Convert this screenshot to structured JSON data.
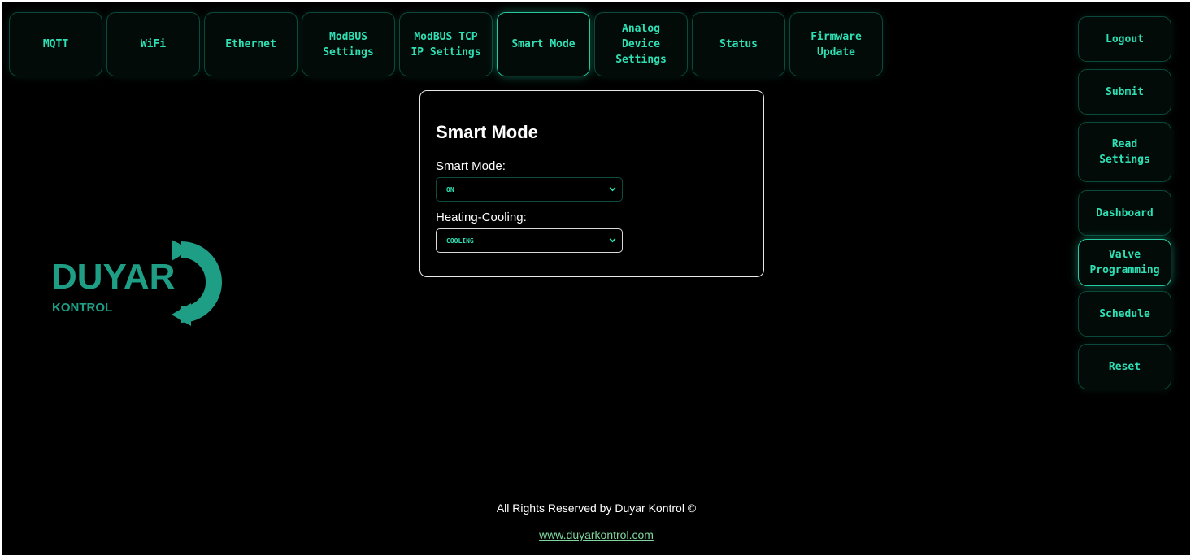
{
  "nav": {
    "tabs": [
      {
        "label": "MQTT"
      },
      {
        "label": "WiFi"
      },
      {
        "label": "Ethernet"
      },
      {
        "label": "ModBUS\nSettings"
      },
      {
        "label": "ModBUS TCP\nIP Settings"
      },
      {
        "label": "Smart Mode",
        "active": true
      },
      {
        "label": "Analog\nDevice\nSettings"
      },
      {
        "label": "Status"
      },
      {
        "label": "Firmware\nUpdate"
      }
    ]
  },
  "sidebar": {
    "buttons": [
      {
        "label": "Logout"
      },
      {
        "label": "Submit"
      },
      {
        "label": "Read\nSettings"
      },
      {
        "label": "Dashboard"
      },
      {
        "label": "Valve\nProgramming",
        "active": true
      },
      {
        "label": "Schedule"
      },
      {
        "label": "Reset"
      }
    ]
  },
  "panel": {
    "title": "Smart Mode",
    "smart_mode_label": "Smart Mode:",
    "smart_mode_value": "ON",
    "heating_cooling_label": "Heating-Cooling:",
    "heating_cooling_value": "COOLING"
  },
  "logo": {
    "name": "DUYAR",
    "sub": "KONTROL",
    "color": "#1f9e86"
  },
  "footer": {
    "copyright": "All Rights Reserved by Duyar Kontrol ©",
    "link": "www.duyarkontrol.com"
  },
  "colors": {
    "accent": "#2fe0b5",
    "background": "#000000",
    "border": "#0b4a3b"
  }
}
